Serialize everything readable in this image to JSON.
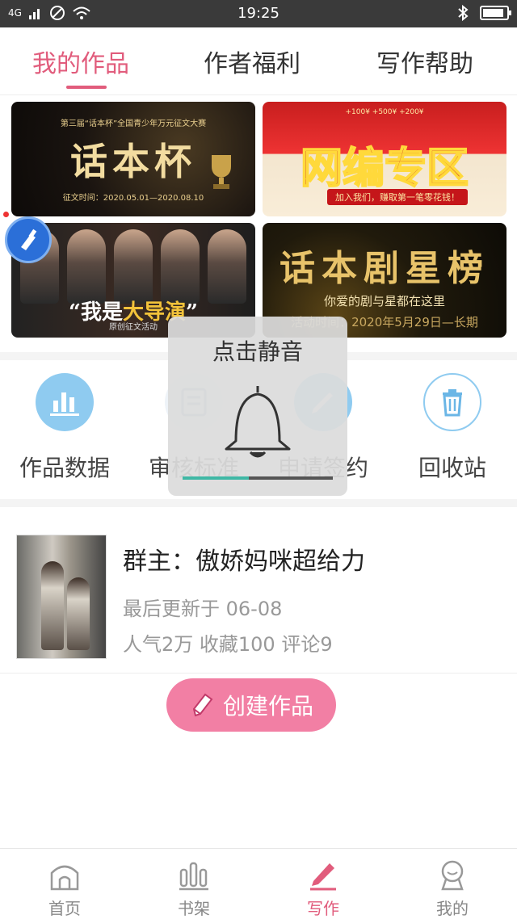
{
  "status_bar": {
    "network": "4G",
    "time": "19:25",
    "battery_level": 0.9
  },
  "top_tabs": [
    {
      "label": "我的作品",
      "active": true
    },
    {
      "label": "作者福利",
      "active": false
    },
    {
      "label": "写作帮助",
      "active": false
    }
  ],
  "banners": {
    "b1": {
      "top": "第三届“话本杯”全国青少年万元征文大赛",
      "title": "话本杯",
      "date": "征文时间：2020.05.01—2020.08.10"
    },
    "b2": {
      "top": "+100¥  +500¥  +200¥",
      "title": "网编专区",
      "tag": "加入我们，赚取第一笔零花钱！"
    },
    "b3": {
      "title_prefix": "“我是",
      "title_accent": "大导演",
      "title_suffix": "”",
      "sub": "原创征文活动"
    },
    "b4": {
      "title": "话本剧星榜",
      "sub": "你爱的剧与星都在这里",
      "date": "活动时间：2020年5月29日—长期"
    }
  },
  "tools": [
    {
      "label": "作品数据",
      "icon": "bar-chart-icon"
    },
    {
      "label": "审核标准",
      "icon": "document-icon"
    },
    {
      "label": "申请签约",
      "icon": "sign-contract-icon"
    },
    {
      "label": "回收站",
      "icon": "trash-icon"
    }
  ],
  "toast": {
    "title": "点击静音",
    "icon": "bell-icon",
    "volume_level": 0.44
  },
  "work": {
    "title": "群主：傲娇妈咪超给力",
    "updated": "最后更新于 06-08",
    "stats": "人气2万 收藏100 评论9"
  },
  "create_button": {
    "label": "创建作品",
    "icon": "pencil-icon"
  },
  "bottom_nav": [
    {
      "label": "首页",
      "icon": "home-icon",
      "active": false
    },
    {
      "label": "书架",
      "icon": "bookshelf-icon",
      "active": false
    },
    {
      "label": "写作",
      "icon": "pen-icon",
      "active": true
    },
    {
      "label": "我的",
      "icon": "profile-icon",
      "active": false
    }
  ],
  "colors": {
    "accent": "#e15c7c",
    "create_button": "#f27fa4",
    "tool_blue": "#8fcbf0",
    "toast_progress": "#3fb8a5"
  }
}
